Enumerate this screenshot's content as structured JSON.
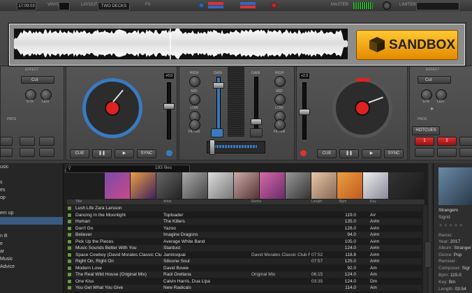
{
  "topbar": {
    "time": "17:09:03",
    "vinyl_label": "VINYL",
    "layout_label": "LAYOUT",
    "layout_value": "TWO DECKS",
    "fx_label": "FX",
    "master_label": "MASTER",
    "limiter_label": "LIMITER"
  },
  "sandbox": {
    "label": "SANDBOX"
  },
  "deck_left": {
    "effect_label": "EFFECT",
    "effect_value": "Cut",
    "str_label": "STR",
    "len_label": "LEN",
    "pads_label": "PADS",
    "pitch_value": "+0.0",
    "cue_label": "CUE",
    "sync_label": "SYNC"
  },
  "deck_right": {
    "effect_label": "EFFECT",
    "effect_value": "Cut",
    "str_label": "STR",
    "len_label": "LEN",
    "pads_label": "PADS",
    "pitch_value": "+2.3",
    "hotcues_label": "HOTCUES",
    "cue_label": "CUE",
    "sync_label": "SYNC",
    "pad1": "1",
    "pad2": "2"
  },
  "mixer": {
    "high_label": "HIGH",
    "mid_label": "MID",
    "low_label": "LOW",
    "filter_label": "FILTER",
    "gain_label": "GAIN"
  },
  "sidebar": {
    "items": [
      "usic",
      "",
      "s",
      "es",
      "op",
      "",
      "em up",
      "",
      "",
      "n B",
      "e",
      "ar",
      "Music",
      "Advice"
    ]
  },
  "browser": {
    "files_count": "193 files",
    "columns": {
      "title": "Title",
      "artist": "Artist",
      "remix": "Remix",
      "length": "Length",
      "bpm": "Bpm",
      "key": "Key"
    },
    "rows": [
      {
        "title": "Lush Life Zara Larsson",
        "artist": "",
        "remix": "",
        "length": "",
        "bpm": "",
        "key": ""
      },
      {
        "title": "Dancing In the Moonlight",
        "artist": "Toploader",
        "remix": "",
        "length": "",
        "bpm": "119.0",
        "key": "A#"
      },
      {
        "title": "Human",
        "artist": "The Killers",
        "remix": "",
        "length": "",
        "bpm": "135.0",
        "key": "A#m"
      },
      {
        "title": "Don't Go",
        "artist": "Yazoo",
        "remix": "",
        "length": "",
        "bpm": "126.0",
        "key": "A#m"
      },
      {
        "title": "Believer",
        "artist": "Imagine Dragons",
        "remix": "",
        "length": "",
        "bpm": "94.0",
        "key": "A#m"
      },
      {
        "title": "Pick Up the Pieces",
        "artist": "Average White Band",
        "remix": "",
        "length": "",
        "bpm": "105.0",
        "key": "A#m"
      },
      {
        "title": "Music Sounds Better With You",
        "artist": "Stardust",
        "remix": "",
        "length": "",
        "bpm": "124.0",
        "key": "A#m"
      },
      {
        "title": "Space Cowboy (David Morales Classic Club Remix)",
        "artist": "Jamiroquai",
        "remix": "David Morales Classic Club Remix",
        "length": "07:52",
        "bpm": "118.8",
        "key": "A#m"
      },
      {
        "title": "Right On, Right On",
        "artist": "Silicone Soul",
        "remix": "",
        "length": "07:57",
        "bpm": "125.0",
        "key": "A#m"
      },
      {
        "title": "Modern Love",
        "artist": "David Bowie",
        "remix": "",
        "length": "",
        "bpm": "92.0",
        "key": "Am"
      },
      {
        "title": "The Real Wild House (Original Mix)",
        "artist": "Raúl Orellana",
        "remix": "Original Mix",
        "length": "06:15",
        "bpm": "124.0",
        "key": "Am"
      },
      {
        "title": "One Kiss",
        "artist": "Calvin Harris, Dua Lipa",
        "remix": "",
        "length": "03:35",
        "bpm": "124.0",
        "key": "Dm"
      },
      {
        "title": "You Get What You Give",
        "artist": "New Radicals",
        "remix": "",
        "length": "",
        "bpm": "114.0",
        "key": "Am"
      }
    ]
  },
  "info": {
    "track_title": "Strangers",
    "track_artist": "Sigrid",
    "remix_label": "Remix:",
    "year_label": "Year:",
    "year_value": "2017",
    "album_label": "Album:",
    "album_value": "Stranger",
    "genre_label": "Genre:",
    "genre_value": "Pop",
    "remixer_label": "Remixer:",
    "composer_label": "Composer:",
    "composer_value": "Sigr",
    "bpm_label": "Bpm:",
    "bpm_value": "115.0",
    "key_label": "Key:",
    "key_value": "Bm",
    "length_label": "Length:",
    "length_value": "03:54"
  }
}
